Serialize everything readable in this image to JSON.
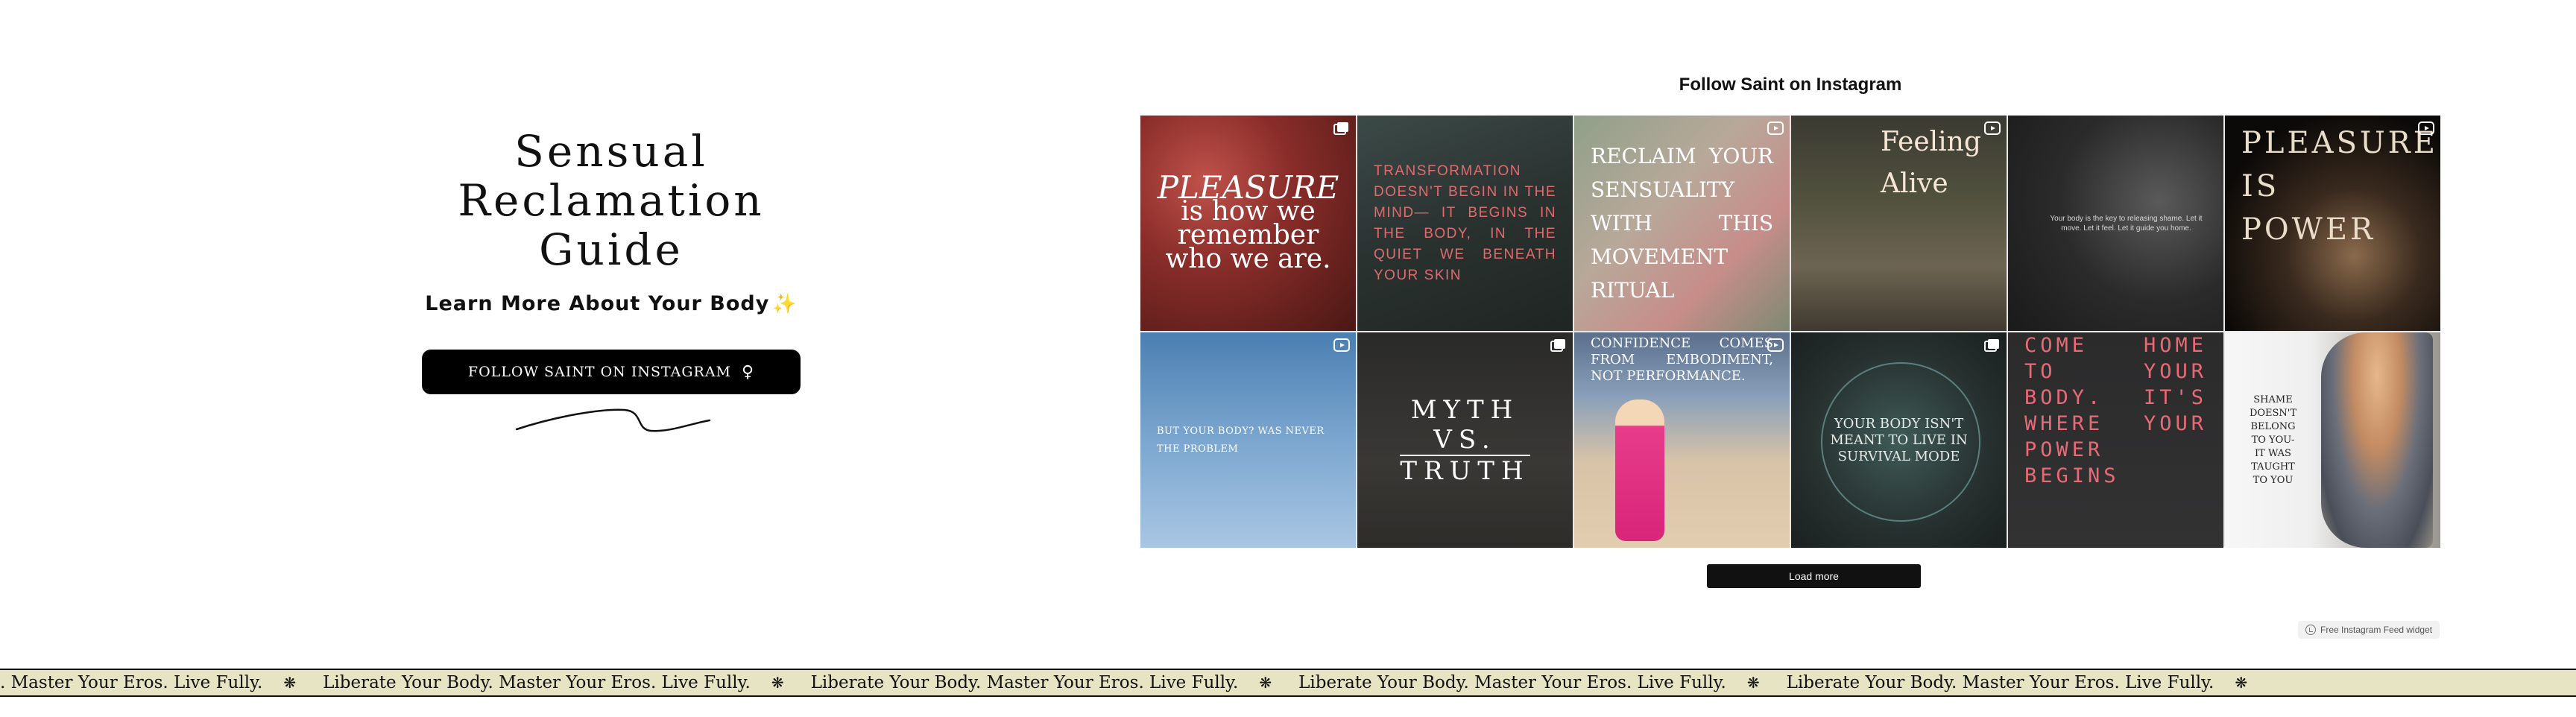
{
  "hero": {
    "title_lines": [
      "Sensual",
      "Reclamation",
      "Guide"
    ],
    "subtitle": "Learn More About Your Body",
    "subtitle_emoji": "✨",
    "button_label": "FOLLOW SAINT ON INSTAGRAM",
    "button_icon": "♀"
  },
  "feed": {
    "title": "Follow Saint on Instagram",
    "posts": [
      {
        "text_a": "PLEASURE",
        "text_b": "is how we remember who we are.",
        "badge": "carousel-icon"
      },
      {
        "text": "TRANSFORMATION DOESN'T BEGIN IN THE MIND— IT BEGINS IN THE BODY, IN THE QUIET WE BENEATH YOUR SKIN",
        "badge": "none"
      },
      {
        "text": "RECLAIM YOUR SENSUALITY WITH THIS MOVEMENT RITUAL",
        "badge": "reel-icon"
      },
      {
        "text": "Feeling Alive",
        "badge": "reel-icon"
      },
      {
        "text": "Your body is the key to releasing shame. Let it move. Let it feel. Let it guide you home.",
        "badge": "none"
      },
      {
        "text": "PLEASURE IS POWER",
        "badge": "reel-icon"
      },
      {
        "text": "BUT YOUR BODY? WAS NEVER THE PROBLEM",
        "badge": "reel-icon"
      },
      {
        "text_a": "MYTH",
        "text_b": "VS.",
        "text_c": "TRUTH",
        "badge": "carousel-icon"
      },
      {
        "text": "CONFIDENCE COMES FROM EMBODIMENT, NOT PERFORMANCE.",
        "badge": "reel-icon"
      },
      {
        "text": "YOUR BODY ISN'T MEANT TO LIVE IN SURVIVAL MODE",
        "badge": "carousel-icon"
      },
      {
        "text": "COME HOME TO YOUR BODY. IT'S WHERE YOUR POWER BEGINS",
        "badge": "none"
      },
      {
        "text": "SHAME DOESN'T BELONG TO YOU- IT WAS TAUGHT TO YOU",
        "badge": "none"
      }
    ],
    "load_more_label": "Load more",
    "widget_label": "Free Instagram Feed widget"
  },
  "marquee": {
    "lead_fragment": ". Master Your Eros. Live Fully.",
    "phrase": "Liberate Your Body. Master Your Eros. Live Fully.",
    "separator": "❋"
  }
}
